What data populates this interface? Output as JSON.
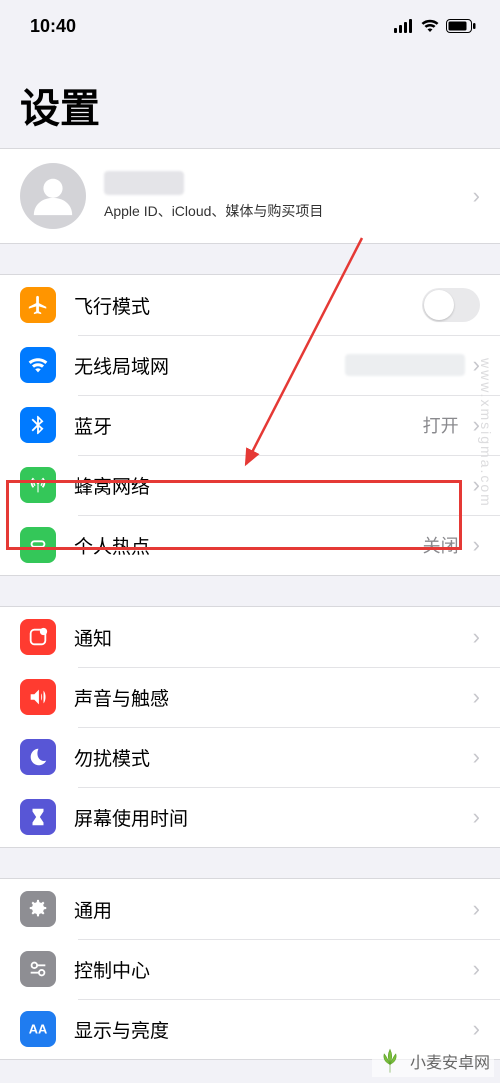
{
  "status": {
    "time": "10:40"
  },
  "title": "设置",
  "profile": {
    "subtitle": "Apple ID、iCloud、媒体与购买项目"
  },
  "rows": {
    "airplane": {
      "label": "飞行模式"
    },
    "wifi": {
      "label": "无线局域网"
    },
    "bluetooth": {
      "label": "蓝牙",
      "detail": "打开"
    },
    "cellular": {
      "label": "蜂窝网络"
    },
    "hotspot": {
      "label": "个人热点",
      "detail": "关闭"
    },
    "notify": {
      "label": "通知"
    },
    "sound": {
      "label": "声音与触感"
    },
    "dnd": {
      "label": "勿扰模式"
    },
    "screentime": {
      "label": "屏幕使用时间"
    },
    "general": {
      "label": "通用"
    },
    "control": {
      "label": "控制中心"
    },
    "display": {
      "label": "显示与亮度"
    }
  },
  "watermark": {
    "side": "www.xmsigma.com",
    "bottom": "小麦安卓网"
  }
}
